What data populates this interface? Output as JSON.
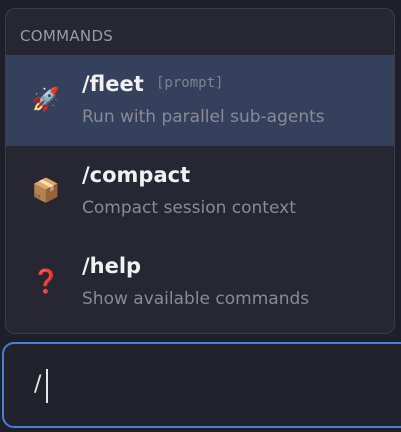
{
  "popup": {
    "header": "COMMANDS",
    "items": [
      {
        "icon": "rocket-icon",
        "glyph": "🚀",
        "name": "/fleet",
        "hint": "[prompt]",
        "description": "Run with parallel sub-agents",
        "selected": true
      },
      {
        "icon": "package-icon",
        "glyph": "📦",
        "name": "/compact",
        "hint": "",
        "description": "Compact session context",
        "selected": false
      },
      {
        "icon": "question-mark-icon",
        "glyph": "❓",
        "name": "/help",
        "hint": "",
        "description": "Show available commands",
        "selected": false
      }
    ]
  },
  "input": {
    "value": "/"
  },
  "colors": {
    "background": "#1f1f29",
    "popup_bg": "#272734",
    "selected_bg": "#34405c",
    "input_border": "#4a7fd6"
  }
}
